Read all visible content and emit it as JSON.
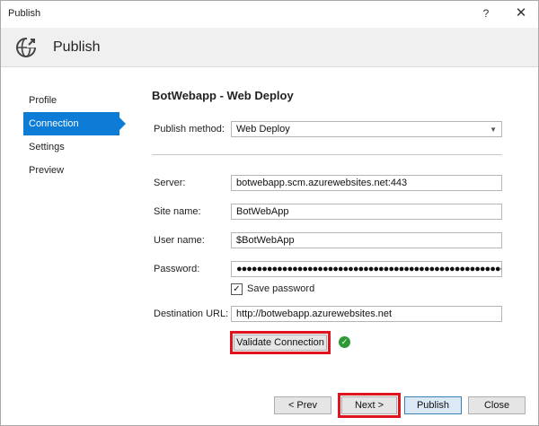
{
  "window": {
    "title": "Publish",
    "help_label": "?",
    "close_label": "✕"
  },
  "header": {
    "title": "Publish",
    "icon": "globe-publish-icon"
  },
  "sidebar": {
    "items": [
      {
        "label": "Profile",
        "active": false
      },
      {
        "label": "Connection",
        "active": true
      },
      {
        "label": "Settings",
        "active": false
      },
      {
        "label": "Preview",
        "active": false
      }
    ]
  },
  "content": {
    "title": "BotWebapp - Web Deploy",
    "publish_method": {
      "label": "Publish method:",
      "value": "Web Deploy"
    },
    "server": {
      "label": "Server:",
      "value": "botwebapp.scm.azurewebsites.net:443"
    },
    "site_name": {
      "label": "Site name:",
      "value": "BotWebApp"
    },
    "user_name": {
      "label": "User name:",
      "value": "$BotWebApp"
    },
    "password": {
      "label": "Password:",
      "value": "●●●●●●●●●●●●●●●●●●●●●●●●●●●●●●●●●●●●●●●●●●●●●●●●●●●●●●●●●●"
    },
    "save_password": {
      "label": "Save password",
      "checked": true
    },
    "destination_url": {
      "label": "Destination URL:",
      "value": "http://botwebapp.azurewebsites.net"
    },
    "validate_button": "Validate Connection",
    "validation_status": "success"
  },
  "footer": {
    "prev": "< Prev",
    "next": "Next >",
    "publish": "Publish",
    "close": "Close"
  },
  "colors": {
    "accent": "#0d7cd6",
    "highlight": "#e0141e",
    "success": "#2e9a35"
  }
}
